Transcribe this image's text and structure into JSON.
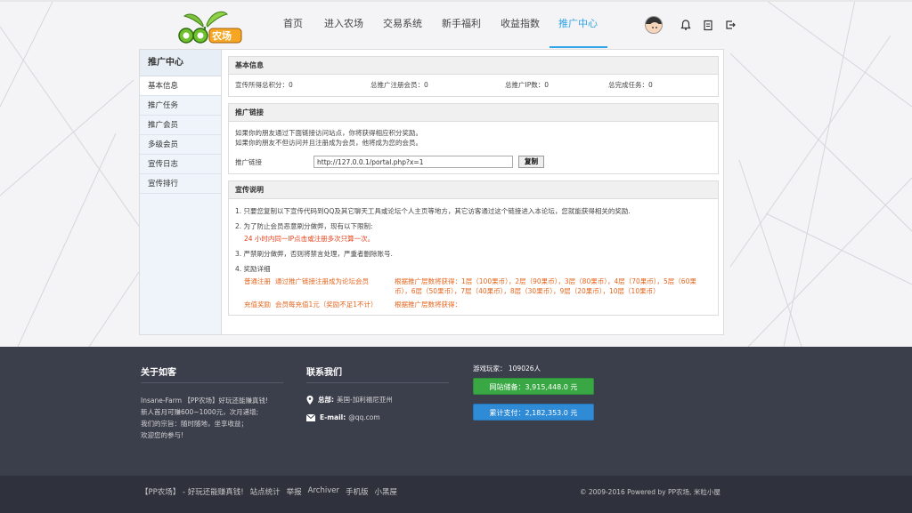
{
  "nav": {
    "items": [
      "首页",
      "进入农场",
      "交易系统",
      "新手福利",
      "收益指数",
      "推广中心"
    ],
    "active_index": 5
  },
  "logo": {
    "icon": "sprout-logo",
    "text": "QQ农场"
  },
  "header_icons": [
    "avatar",
    "bell-icon",
    "clipboard-icon",
    "logout-icon"
  ],
  "sidebar": {
    "title": "推广中心",
    "items": [
      "基本信息",
      "推广任务",
      "推广会员",
      "多级会员",
      "宣传日志",
      "宣传排行"
    ]
  },
  "basic": {
    "title": "基本信息",
    "stats": [
      "宣传所得总积分：0",
      "总推广注册会员：0",
      "总推广IP数：0",
      "总完成任务：0"
    ]
  },
  "promo_link": {
    "title": "推广链接",
    "line1": "如果你的朋友通过下面链接访问站点，你将获得相应积分奖励。",
    "line2": "如果你的朋友不但访问并且注册成为会员，他将成为您的会员。",
    "label": "推广链接",
    "url": "http://127.0.0.1/portal.php?x=1",
    "copy_label": "复制"
  },
  "desc": {
    "title": "宣传说明",
    "p1": "1. 只要您复制以下宣传代码到QQ及其它聊天工具或论坛个人主页等地方，其它访客通过这个链接进入本论坛，您就能获得相关的奖励.",
    "p2": "2. 为了防止会员恶意刷分做弊，现有以下限制:",
    "p2_rule": "24 小时内同一IP点击或注册多次只算一次。",
    "p3": "3. 严禁刷分做弊，否则将禁言处理，严重者删除账号.",
    "p4": "4. 奖励详细",
    "reward1": {
      "name": "普通注册",
      "cond": "通过推广链接注册成为论坛会员",
      "detail": "根据推广层数将获得：1层（100果币），2层（90果币），3层（80果币），4层（70果币），5层（60果币），6层（50果币），7层（40果币），8层（30果币），9层（20果币），10层（10果币）"
    },
    "reward2": {
      "name": "充值奖励",
      "cond": "会员每充值1元（奖励不足1不计）",
      "detail": "根据推广层数将获得："
    }
  },
  "footer": {
    "about_title": "关于如客",
    "about_lines": [
      "Insane-Farm 【PP农场】好玩还能赚真钱!",
      "新人首月可赚600~1000元，次月递增;",
      "我们的宗旨：随时随地，坐享收益；",
      "欢迎您的参与!"
    ],
    "contact_title": "联系我们",
    "address_label": "总部:",
    "address": "美国-加利福尼亚州",
    "email_label": "E-mail:",
    "email": "@qq.com",
    "players": "游戏玩家： 109026人",
    "stored": "网站储备：3,915,448.0 元",
    "paid": "累计支付：2,182,353.0 元"
  },
  "bottom": {
    "links": [
      "【PP农场】 - 好玩还能赚真钱!",
      "站点统计",
      "举报",
      "Archiver",
      "手机版",
      "小黑屋"
    ],
    "copyright": "© 2009-2016  Powered by PP农场, 米粒小屋"
  },
  "colors": {
    "accent": "#2fa4e7",
    "footer_bg": "#3b3e4b",
    "highlight": "#e5651e"
  }
}
